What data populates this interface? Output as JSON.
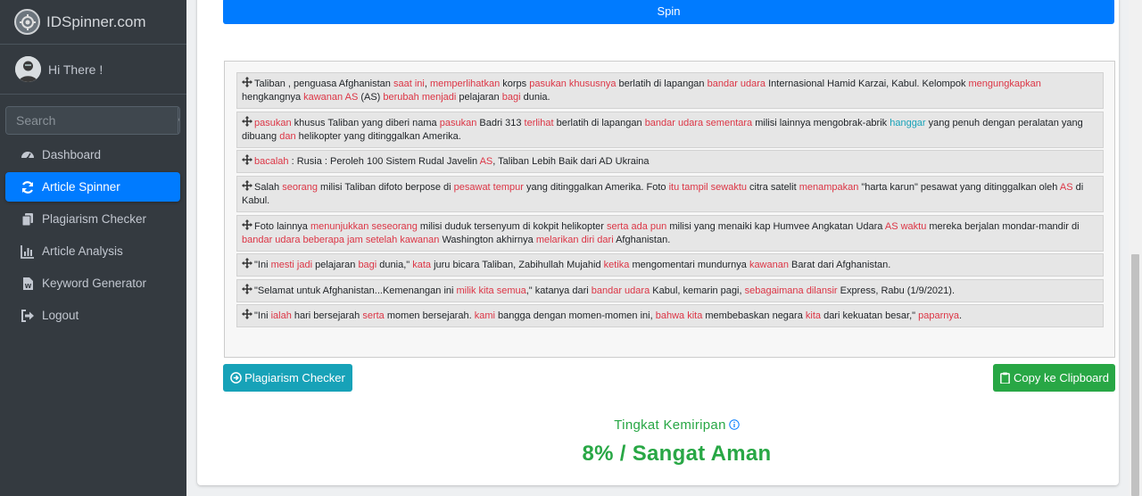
{
  "sidebar": {
    "brand": "IDSpinner.com",
    "user": "Hi There !",
    "search_placeholder": "Search",
    "nav": [
      {
        "label": "Dashboard",
        "icon": "dashboard-icon"
      },
      {
        "label": "Article Spinner",
        "icon": "refresh-icon",
        "active": true
      },
      {
        "label": "Plagiarism Checker",
        "icon": "copy-icon"
      },
      {
        "label": "Article Analysis",
        "icon": "chart-icon"
      },
      {
        "label": "Keyword Generator",
        "icon": "word-file-icon"
      },
      {
        "label": "Logout",
        "icon": "sign-out-icon"
      }
    ]
  },
  "main": {
    "spin_label": "Spin",
    "plagiarism_button": "Plagiarism Checker",
    "copy_button": "Copy ke Clipboard",
    "similarity_label": "Tingkat Kemiripan",
    "similarity_value": "8% / Sangat Aman"
  },
  "sentences": [
    [
      [
        "n",
        "Taliban , penguasa Afghanistan "
      ],
      [
        "r",
        "saat ini"
      ],
      [
        "n",
        ", "
      ],
      [
        "r",
        "memperlihatkan"
      ],
      [
        "n",
        " korps "
      ],
      [
        "r",
        "pasukan khususnya"
      ],
      [
        "n",
        " berlatih di lapangan "
      ],
      [
        "r",
        "bandar udara"
      ],
      [
        "n",
        " Internasional Hamid Karzai, Kabul. Kelompok "
      ],
      [
        "r",
        "mengungkapkan"
      ],
      [
        "n",
        " hengkangnya "
      ],
      [
        "r",
        "kawanan AS"
      ],
      [
        "n",
        " (AS) "
      ],
      [
        "r",
        "berubah menjadi"
      ],
      [
        "n",
        " pelajaran "
      ],
      [
        "r",
        "bagi"
      ],
      [
        "n",
        " dunia."
      ]
    ],
    [
      [
        "r",
        "pasukan"
      ],
      [
        "n",
        " khusus Taliban yang diberi nama "
      ],
      [
        "r",
        "pasukan"
      ],
      [
        "n",
        " Badri 313 "
      ],
      [
        "r",
        "terlihat"
      ],
      [
        "n",
        " berlatih di lapangan "
      ],
      [
        "r",
        "bandar udara sementara"
      ],
      [
        "n",
        " milisi lainnya mengobrak-abrik "
      ],
      [
        "t",
        "hanggar"
      ],
      [
        "n",
        " yang penuh dengan peralatan yang dibuang "
      ],
      [
        "r",
        "dan"
      ],
      [
        "n",
        " helikopter yang ditinggalkan Amerika."
      ]
    ],
    [
      [
        "r",
        "bacalah"
      ],
      [
        "n",
        " : Rusia : Peroleh 100 Sistem Rudal Javelin "
      ],
      [
        "r",
        "AS"
      ],
      [
        "n",
        ", Taliban Lebih Baik dari AD Ukraina"
      ]
    ],
    [
      [
        "n",
        "Salah "
      ],
      [
        "r",
        "seorang"
      ],
      [
        "n",
        " milisi Taliban difoto berpose di "
      ],
      [
        "r",
        "pesawat tempur"
      ],
      [
        "n",
        " yang ditinggalkan Amerika. Foto "
      ],
      [
        "r",
        "itu tampil sewaktu"
      ],
      [
        "n",
        " citra satelit "
      ],
      [
        "r",
        "menampakan"
      ],
      [
        "n",
        " \"harta karun\" pesawat yang ditinggalkan oleh "
      ],
      [
        "r",
        "AS"
      ],
      [
        "n",
        " di Kabul."
      ]
    ],
    [
      [
        "n",
        "Foto lainnya "
      ],
      [
        "r",
        "menunjukkan seseorang"
      ],
      [
        "n",
        " milisi duduk tersenyum di kokpit helikopter "
      ],
      [
        "r",
        "serta ada pun"
      ],
      [
        "n",
        " milisi yang menaiki kap Humvee Angkatan Udara "
      ],
      [
        "r",
        "AS waktu"
      ],
      [
        "n",
        " mereka berjalan mondar-mandir di "
      ],
      [
        "r",
        "bandar udara beberapa jam setelah kawanan"
      ],
      [
        "n",
        " Washington akhirnya "
      ],
      [
        "r",
        "melarikan diri dari"
      ],
      [
        "n",
        " Afghanistan."
      ]
    ],
    [
      [
        "n",
        "\"Ini "
      ],
      [
        "r",
        "mesti jadi"
      ],
      [
        "n",
        " pelajaran "
      ],
      [
        "r",
        "bagi"
      ],
      [
        "n",
        " dunia,\" "
      ],
      [
        "r",
        "kata"
      ],
      [
        "n",
        " juru bicara Taliban, Zabihullah Mujahid "
      ],
      [
        "r",
        "ketika"
      ],
      [
        "n",
        " mengomentari mundurnya "
      ],
      [
        "r",
        "kawanan"
      ],
      [
        "n",
        " Barat dari Afghanistan."
      ]
    ],
    [
      [
        "n",
        "\"Selamat untuk Afghanistan...Kemenangan ini "
      ],
      [
        "r",
        "milik kita semua"
      ],
      [
        "n",
        ",\" katanya dari "
      ],
      [
        "r",
        "bandar udara"
      ],
      [
        "n",
        " Kabul, kemarin pagi, "
      ],
      [
        "r",
        "sebagaimana dilansir"
      ],
      [
        "n",
        " Express, Rabu (1/9/2021)."
      ]
    ],
    [
      [
        "n",
        "\"Ini "
      ],
      [
        "r",
        "ialah"
      ],
      [
        "n",
        " hari bersejarah "
      ],
      [
        "r",
        "serta"
      ],
      [
        "n",
        " momen bersejarah. "
      ],
      [
        "r",
        "kami"
      ],
      [
        "n",
        " bangga dengan momen-momen ini, "
      ],
      [
        "r",
        "bahwa kita"
      ],
      [
        "n",
        " membebaskan negara "
      ],
      [
        "r",
        "kita"
      ],
      [
        "n",
        " dari kekuatan besar,\" "
      ],
      [
        "r",
        "paparnya"
      ],
      [
        "n",
        "."
      ]
    ]
  ]
}
